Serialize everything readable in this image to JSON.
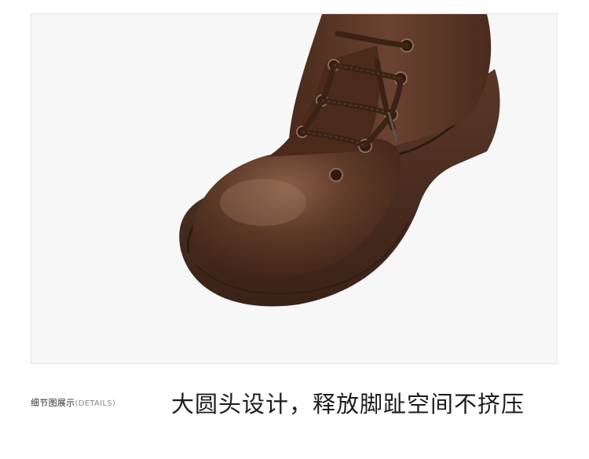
{
  "product_photo": {
    "subject": "brown leather lace-up boot toe, detail view"
  },
  "caption": {
    "section_label_cn": "细节图展示",
    "section_label_en": "(DETAILS)",
    "headline": "大圆头设计，释放脚趾空间不挤压"
  },
  "colors": {
    "leather": "#5a3524",
    "sole": "#4a2c20",
    "background": "#f7f7f7"
  }
}
